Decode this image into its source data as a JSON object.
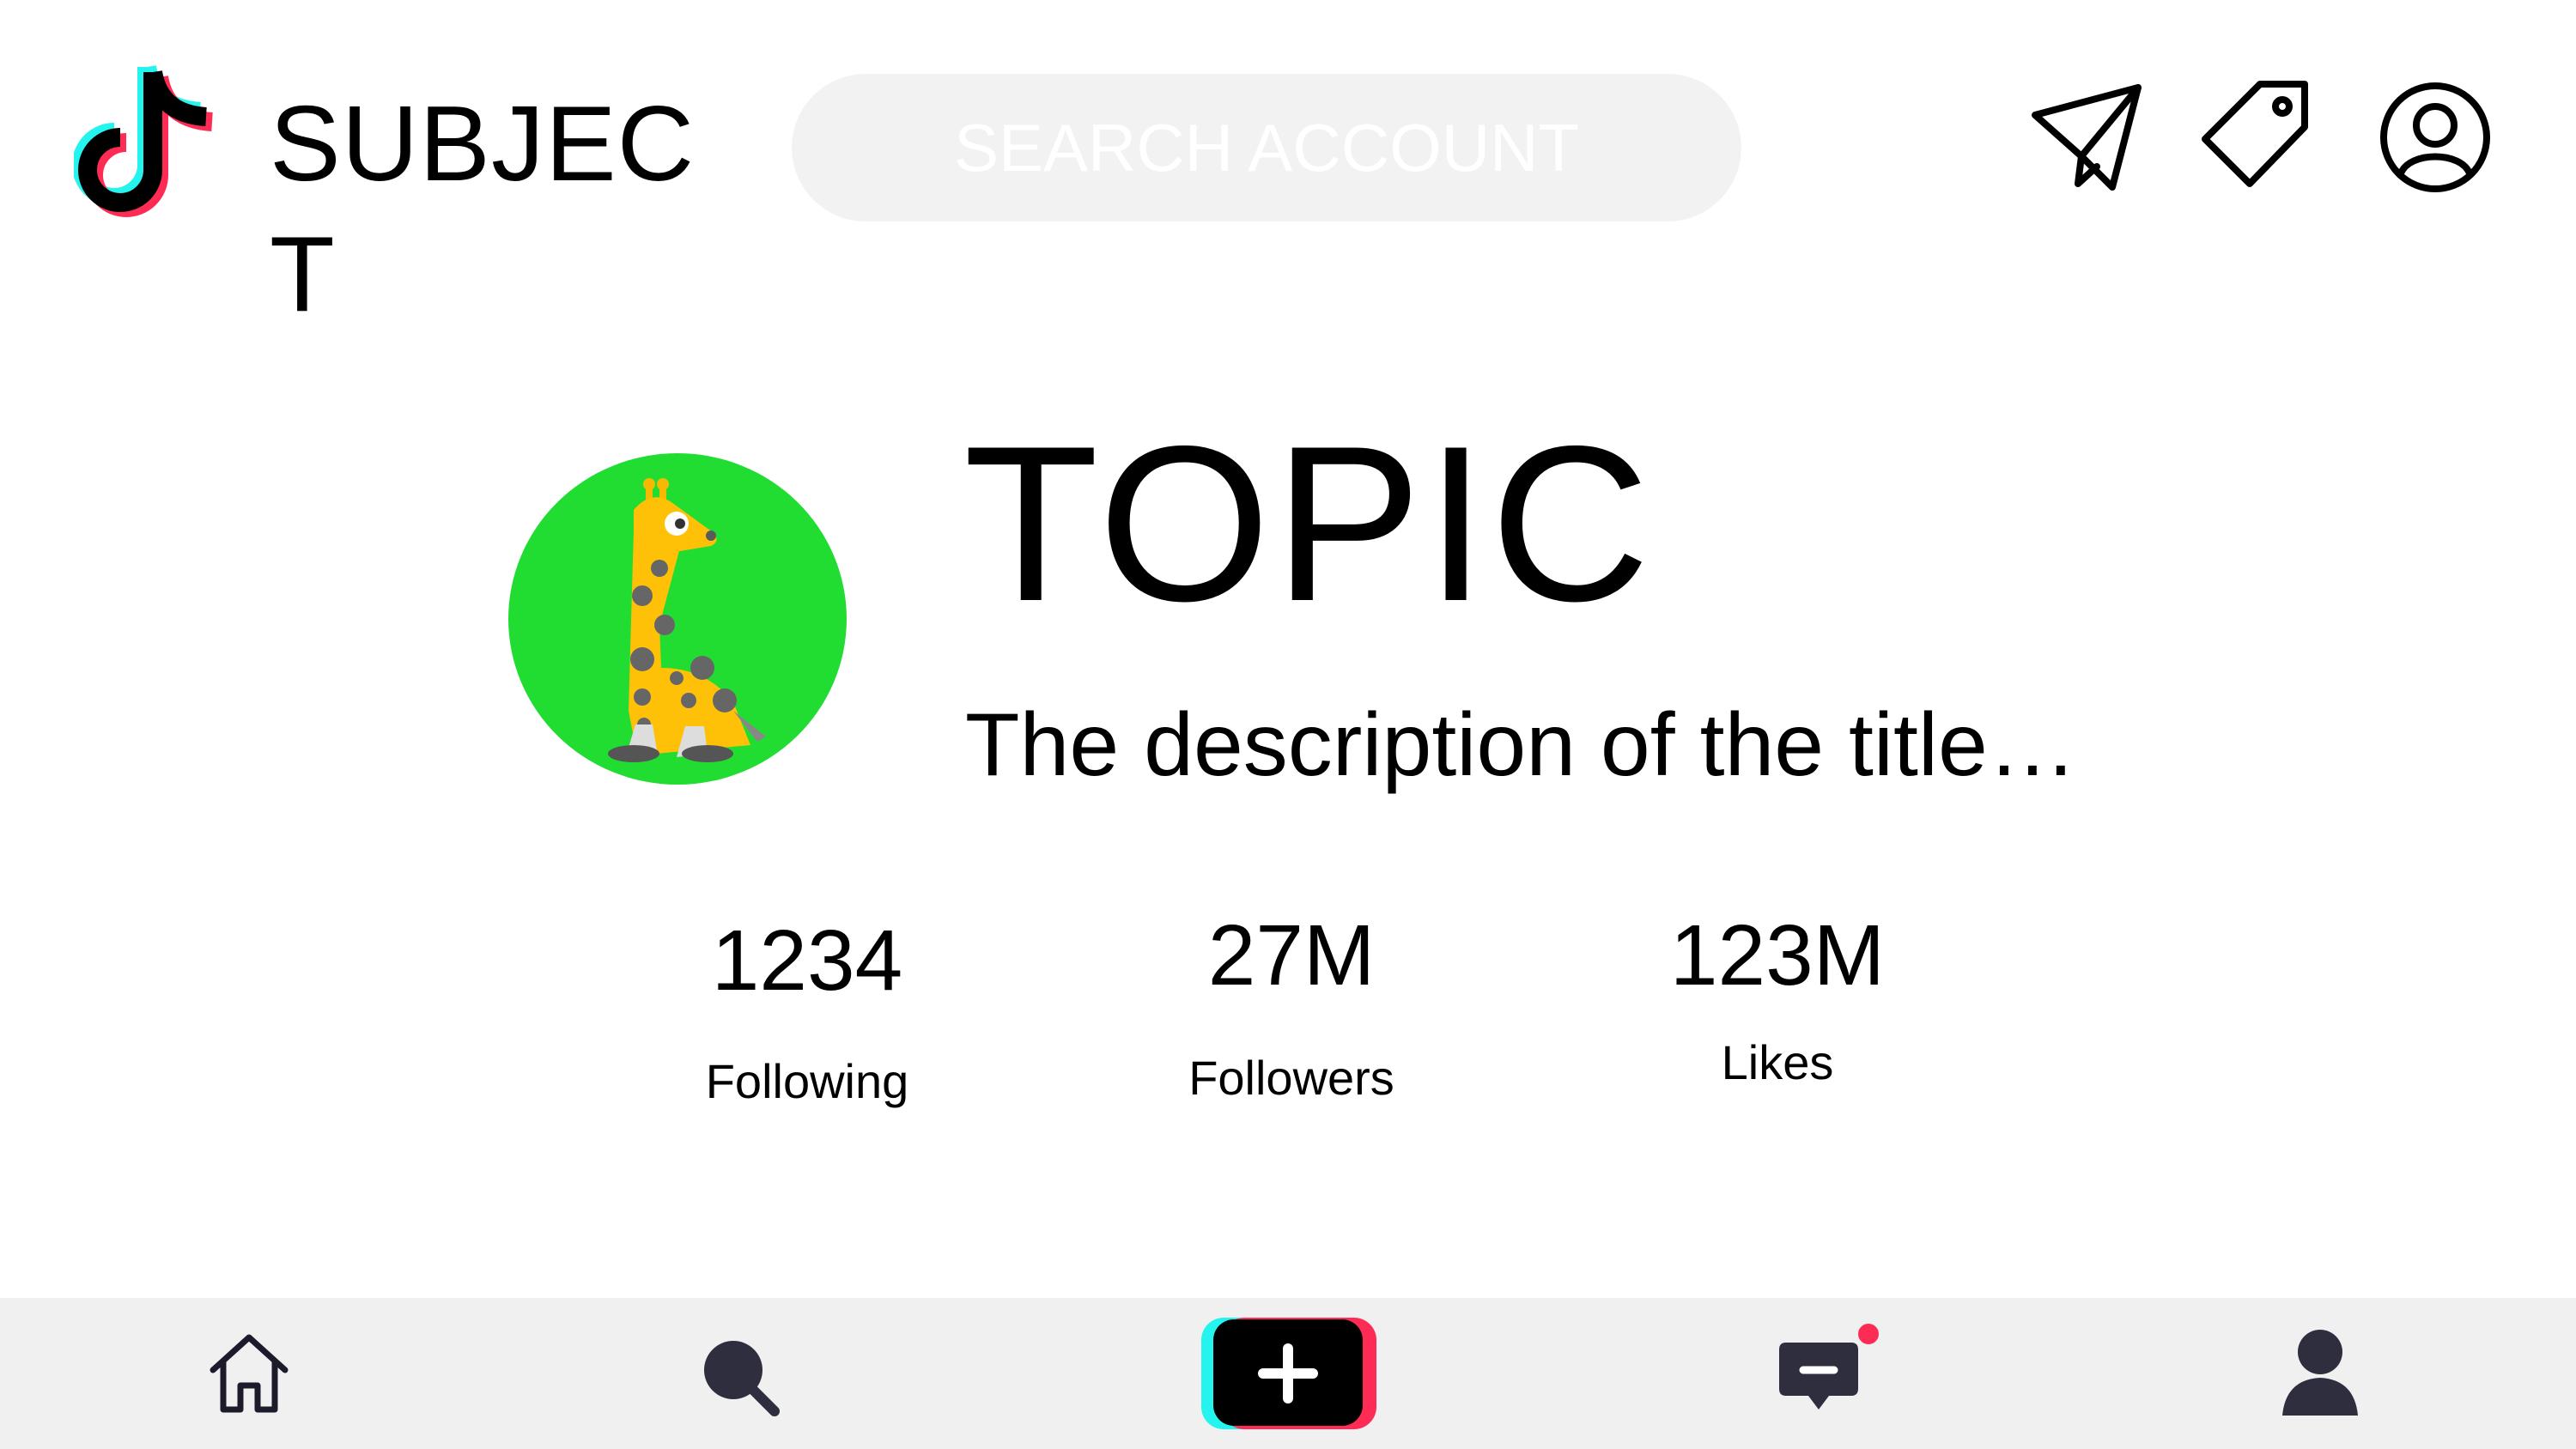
{
  "header": {
    "app_title": "SUBJECT",
    "search": {
      "placeholder": "SEARCH ACCOUNT"
    },
    "icons": [
      "send-icon",
      "tag-icon",
      "account-icon"
    ]
  },
  "profile": {
    "title": "TOPIC",
    "description": "The description of the title…",
    "stats": [
      {
        "value": "1234",
        "label": "Following"
      },
      {
        "value": "27M",
        "label": "Followers"
      },
      {
        "value": "123M",
        "label": "Likes"
      }
    ]
  },
  "bottom_nav": {
    "items": [
      "home-icon",
      "search-icon",
      "create-icon",
      "inbox-icon",
      "profile-icon"
    ]
  },
  "colors": {
    "accent_cyan": "#25f4ee",
    "accent_red": "#fe2c55",
    "avatar_bg": "#21dd32",
    "nav_bg": "#f1f0f1",
    "nav_icon": "#2e2e3e"
  }
}
